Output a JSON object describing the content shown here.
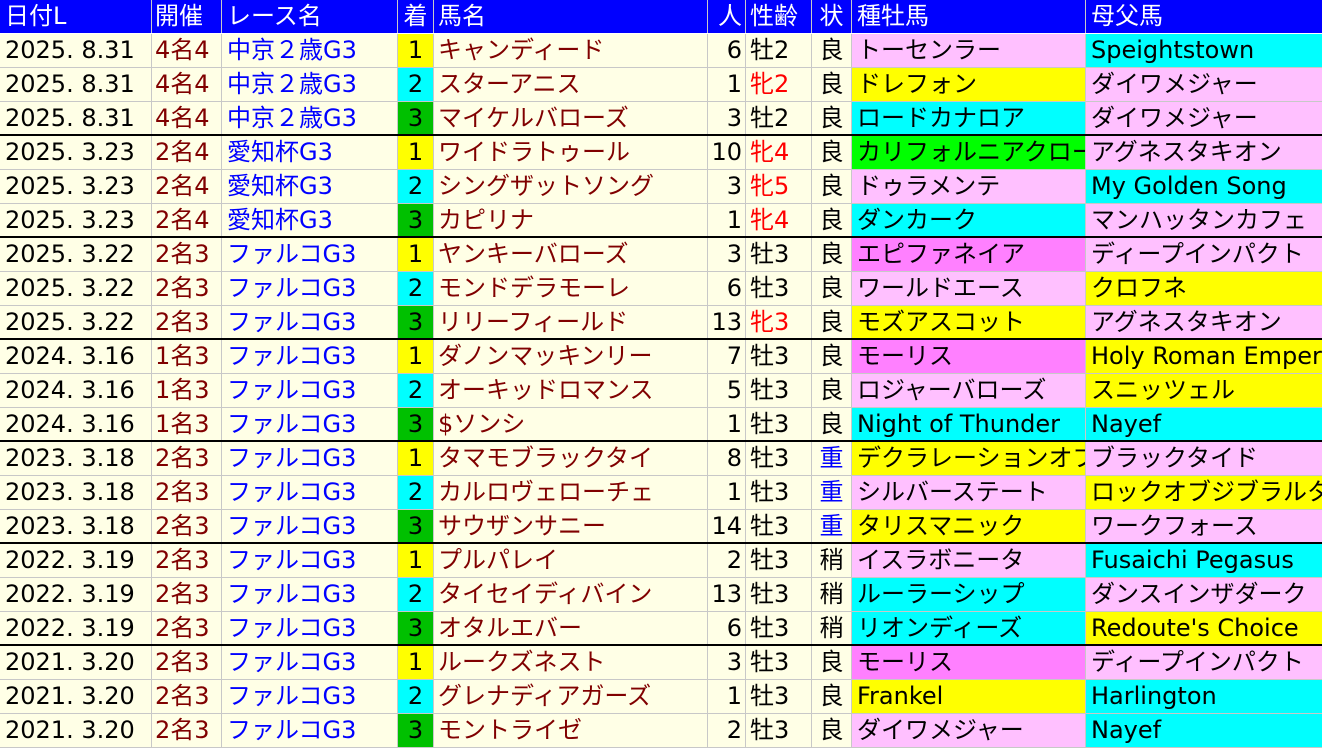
{
  "columns": {
    "date": "日付L",
    "meeting": "開催",
    "race": "レース名",
    "finish": "着",
    "horse": "馬名",
    "popularity": "人",
    "sex_age": "性齢",
    "track": "状",
    "sire": "種牡馬",
    "dam_sire": "母父馬"
  },
  "colors": {
    "header_bg": "#0000ff",
    "row_bg": "#ffffe6",
    "meeting_text": "#800000",
    "race_text": "#0000ff",
    "horse_text": "#800000",
    "female_text": "#ff0000",
    "heavy_track_text": "#0000ff",
    "finish_1": "#ffff00",
    "finish_2": "#00ffff",
    "finish_3": "#00c000",
    "sire_yellow": "#ffff00",
    "sire_cyan": "#00ffff",
    "sire_pink": "#ffc0ff",
    "sire_magenta": "#ff80ff",
    "sire_green": "#00ff00"
  },
  "rows": [
    {
      "date": "2025. 8.31",
      "meeting": "4名4",
      "race": "中京２歳G3",
      "finish": "1",
      "horse": "キャンディード",
      "pop": "6",
      "sex": "牡2",
      "track": "良",
      "sire": "トーセンラー",
      "dam": "Speightstown",
      "female": false,
      "heavy": false,
      "sire_color": "#ffc0ff",
      "dam_color": "#00ffff"
    },
    {
      "date": "2025. 8.31",
      "meeting": "4名4",
      "race": "中京２歳G3",
      "finish": "2",
      "horse": "スターアニス",
      "pop": "1",
      "sex": "牝2",
      "track": "良",
      "sire": "ドレフォン",
      "dam": "ダイワメジャー",
      "female": true,
      "heavy": false,
      "sire_color": "#ffff00",
      "dam_color": "#ffc0ff"
    },
    {
      "date": "2025. 8.31",
      "meeting": "4名4",
      "race": "中京２歳G3",
      "finish": "3",
      "horse": "マイケルバローズ",
      "pop": "3",
      "sex": "牡2",
      "track": "良",
      "sire": "ロードカナロア",
      "dam": "ダイワメジャー",
      "female": false,
      "heavy": false,
      "sire_color": "#00ffff",
      "dam_color": "#ffc0ff"
    },
    {
      "date": "2025. 3.23",
      "meeting": "2名4",
      "race": "愛知杯G3",
      "finish": "1",
      "horse": "ワイドラトゥール",
      "pop": "10",
      "sex": "牝4",
      "track": "良",
      "sire": "カリフォルニアクローム",
      "dam": "アグネスタキオン",
      "female": true,
      "heavy": false,
      "sire_color": "#00ff00",
      "dam_color": "#ffc0ff"
    },
    {
      "date": "2025. 3.23",
      "meeting": "2名4",
      "race": "愛知杯G3",
      "finish": "2",
      "horse": "シングザットソング",
      "pop": "3",
      "sex": "牝5",
      "track": "良",
      "sire": "ドゥラメンテ",
      "dam": "My Golden Song",
      "female": true,
      "heavy": false,
      "sire_color": "#ffc0ff",
      "dam_color": "#00ffff"
    },
    {
      "date": "2025. 3.23",
      "meeting": "2名4",
      "race": "愛知杯G3",
      "finish": "3",
      "horse": "カピリナ",
      "pop": "1",
      "sex": "牝4",
      "track": "良",
      "sire": "ダンカーク",
      "dam": "マンハッタンカフェ",
      "female": true,
      "heavy": false,
      "sire_color": "#00ffff",
      "dam_color": "#ffc0ff"
    },
    {
      "date": "2025. 3.22",
      "meeting": "2名3",
      "race": "ファルコG3",
      "finish": "1",
      "horse": "ヤンキーバローズ",
      "pop": "3",
      "sex": "牡3",
      "track": "良",
      "sire": "エピファネイア",
      "dam": "ディープインパクト",
      "female": false,
      "heavy": false,
      "sire_color": "#ff80ff",
      "dam_color": "#ffc0ff"
    },
    {
      "date": "2025. 3.22",
      "meeting": "2名3",
      "race": "ファルコG3",
      "finish": "2",
      "horse": "モンドデラモーレ",
      "pop": "6",
      "sex": "牡3",
      "track": "良",
      "sire": "ワールドエース",
      "dam": "クロフネ",
      "female": false,
      "heavy": false,
      "sire_color": "#ffc0ff",
      "dam_color": "#ffff00"
    },
    {
      "date": "2025. 3.22",
      "meeting": "2名3",
      "race": "ファルコG3",
      "finish": "3",
      "horse": "リリーフィールド",
      "pop": "13",
      "sex": "牝3",
      "track": "良",
      "sire": "モズアスコット",
      "dam": "アグネスタキオン",
      "female": true,
      "heavy": false,
      "sire_color": "#ffff00",
      "dam_color": "#ffc0ff"
    },
    {
      "date": "2024. 3.16",
      "meeting": "1名3",
      "race": "ファルコG3",
      "finish": "1",
      "horse": "ダノンマッキンリー",
      "pop": "7",
      "sex": "牡3",
      "track": "良",
      "sire": "モーリス",
      "dam": "Holy Roman Emperor",
      "female": false,
      "heavy": false,
      "sire_color": "#ff80ff",
      "dam_color": "#ffff00"
    },
    {
      "date": "2024. 3.16",
      "meeting": "1名3",
      "race": "ファルコG3",
      "finish": "2",
      "horse": "オーキッドロマンス",
      "pop": "5",
      "sex": "牡3",
      "track": "良",
      "sire": "ロジャーバローズ",
      "dam": "スニッツェル",
      "female": false,
      "heavy": false,
      "sire_color": "#ffc0ff",
      "dam_color": "#ffff00"
    },
    {
      "date": "2024. 3.16",
      "meeting": "1名3",
      "race": "ファルコG3",
      "finish": "3",
      "horse": "$ソンシ",
      "pop": "1",
      "sex": "牡3",
      "track": "良",
      "sire": "Night of Thunder",
      "dam": "Nayef",
      "female": false,
      "heavy": false,
      "sire_color": "#00ffff",
      "dam_color": "#00ffff"
    },
    {
      "date": "2023. 3.18",
      "meeting": "2名3",
      "race": "ファルコG3",
      "finish": "1",
      "horse": "タマモブラックタイ",
      "pop": "8",
      "sex": "牡3",
      "track": "重",
      "sire": "デクラレーションオブウォー",
      "dam": "ブラックタイド",
      "female": false,
      "heavy": true,
      "sire_color": "#ffff00",
      "dam_color": "#ffc0ff"
    },
    {
      "date": "2023. 3.18",
      "meeting": "2名3",
      "race": "ファルコG3",
      "finish": "2",
      "horse": "カルロヴェローチェ",
      "pop": "1",
      "sex": "牡3",
      "track": "重",
      "sire": "シルバーステート",
      "dam": "ロックオブジブラルタル",
      "female": false,
      "heavy": true,
      "sire_color": "#ffc0ff",
      "dam_color": "#ffff00"
    },
    {
      "date": "2023. 3.18",
      "meeting": "2名3",
      "race": "ファルコG3",
      "finish": "3",
      "horse": "サウザンサニー",
      "pop": "14",
      "sex": "牡3",
      "track": "重",
      "sire": "タリスマニック",
      "dam": "ワークフォース",
      "female": false,
      "heavy": true,
      "sire_color": "#ffff00",
      "dam_color": "#ffc0ff"
    },
    {
      "date": "2022. 3.19",
      "meeting": "2名3",
      "race": "ファルコG3",
      "finish": "1",
      "horse": "プルパレイ",
      "pop": "2",
      "sex": "牡3",
      "track": "稍",
      "sire": "イスラボニータ",
      "dam": "Fusaichi Pegasus",
      "female": false,
      "heavy": false,
      "sire_color": "#ffc0ff",
      "dam_color": "#00ffff"
    },
    {
      "date": "2022. 3.19",
      "meeting": "2名3",
      "race": "ファルコG3",
      "finish": "2",
      "horse": "タイセイディバイン",
      "pop": "13",
      "sex": "牡3",
      "track": "稍",
      "sire": "ルーラーシップ",
      "dam": "ダンスインザダーク",
      "female": false,
      "heavy": false,
      "sire_color": "#00ffff",
      "dam_color": "#ffc0ff"
    },
    {
      "date": "2022. 3.19",
      "meeting": "2名3",
      "race": "ファルコG3",
      "finish": "3",
      "horse": "オタルエバー",
      "pop": "6",
      "sex": "牡3",
      "track": "稍",
      "sire": "リオンディーズ",
      "dam": "Redoute's Choice",
      "female": false,
      "heavy": false,
      "sire_color": "#00ffff",
      "dam_color": "#ffff00"
    },
    {
      "date": "2021. 3.20",
      "meeting": "2名3",
      "race": "ファルコG3",
      "finish": "1",
      "horse": "ルークズネスト",
      "pop": "3",
      "sex": "牡3",
      "track": "良",
      "sire": "モーリス",
      "dam": "ディープインパクト",
      "female": false,
      "heavy": false,
      "sire_color": "#ff80ff",
      "dam_color": "#ffc0ff"
    },
    {
      "date": "2021. 3.20",
      "meeting": "2名3",
      "race": "ファルコG3",
      "finish": "2",
      "horse": "グレナディアガーズ",
      "pop": "1",
      "sex": "牡3",
      "track": "良",
      "sire": "Frankel",
      "dam": "Harlington",
      "female": false,
      "heavy": false,
      "sire_color": "#ffff00",
      "dam_color": "#00ffff"
    },
    {
      "date": "2021. 3.20",
      "meeting": "2名3",
      "race": "ファルコG3",
      "finish": "3",
      "horse": "モントライゼ",
      "pop": "2",
      "sex": "牡3",
      "track": "良",
      "sire": "ダイワメジャー",
      "dam": "Nayef",
      "female": false,
      "heavy": false,
      "sire_color": "#ffc0ff",
      "dam_color": "#00ffff"
    }
  ]
}
